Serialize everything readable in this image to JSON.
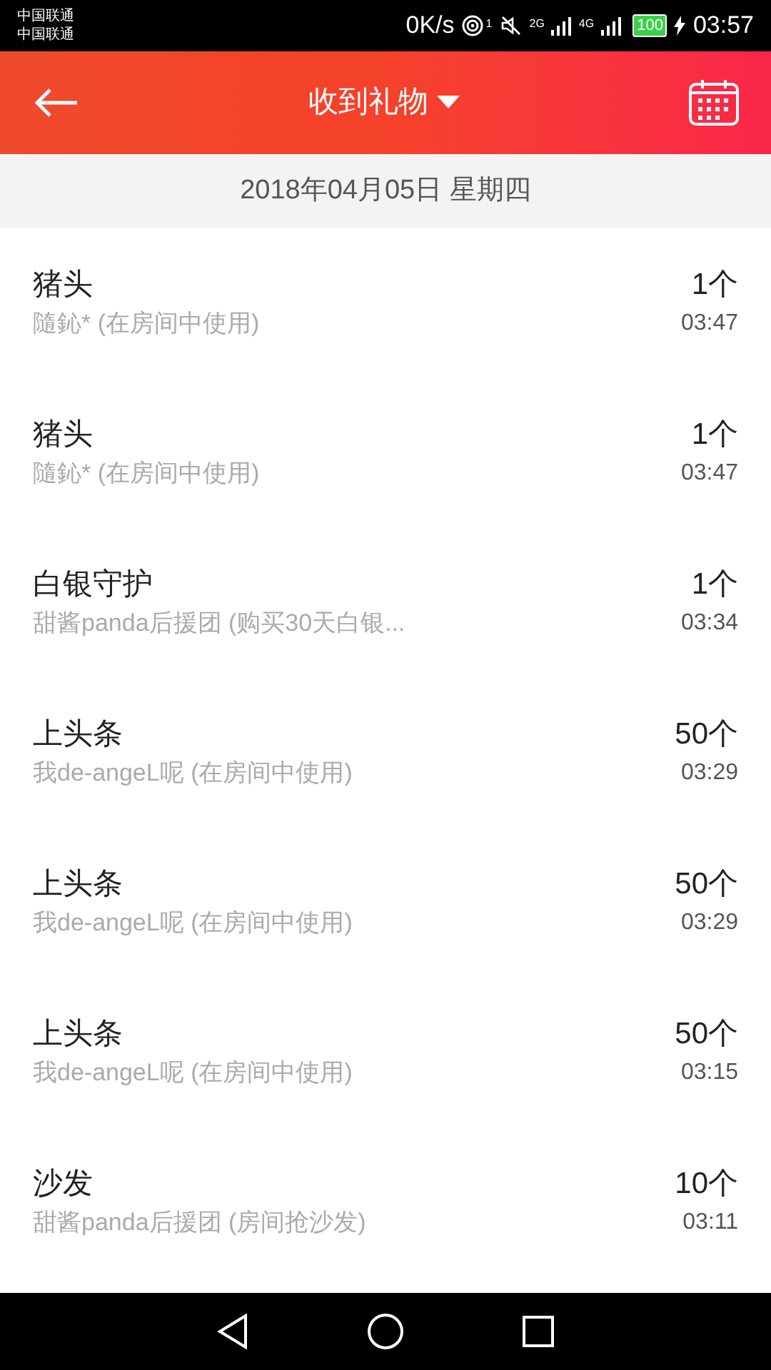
{
  "status_bar": {
    "carriers": [
      "中国联通",
      "中国联通"
    ],
    "speed": "0K/s",
    "hotspot_count": "1",
    "sim1_network": "2G",
    "sim2_network": "4G",
    "battery": "100",
    "time": "03:57"
  },
  "header": {
    "title": "收到礼物"
  },
  "date": "2018年04月05日 星期四",
  "gifts": [
    {
      "name": "猪头",
      "detail": "隨鈊* (在房间中使用)",
      "count": "1个",
      "time": "03:47"
    },
    {
      "name": "猪头",
      "detail": "隨鈊* (在房间中使用)",
      "count": "1个",
      "time": "03:47"
    },
    {
      "name": "白银守护",
      "detail": "甜酱panda后援团 (购买30天白银...",
      "count": "1个",
      "time": "03:34"
    },
    {
      "name": "上头条",
      "detail": "我de-angeL呢 (在房间中使用)",
      "count": "50个",
      "time": "03:29"
    },
    {
      "name": "上头条",
      "detail": "我de-angeL呢 (在房间中使用)",
      "count": "50个",
      "time": "03:29"
    },
    {
      "name": "上头条",
      "detail": "我de-angeL呢 (在房间中使用)",
      "count": "50个",
      "time": "03:15"
    },
    {
      "name": "沙发",
      "detail": "甜酱panda后援团 (房间抢沙发)",
      "count": "10个",
      "time": "03:11"
    }
  ]
}
